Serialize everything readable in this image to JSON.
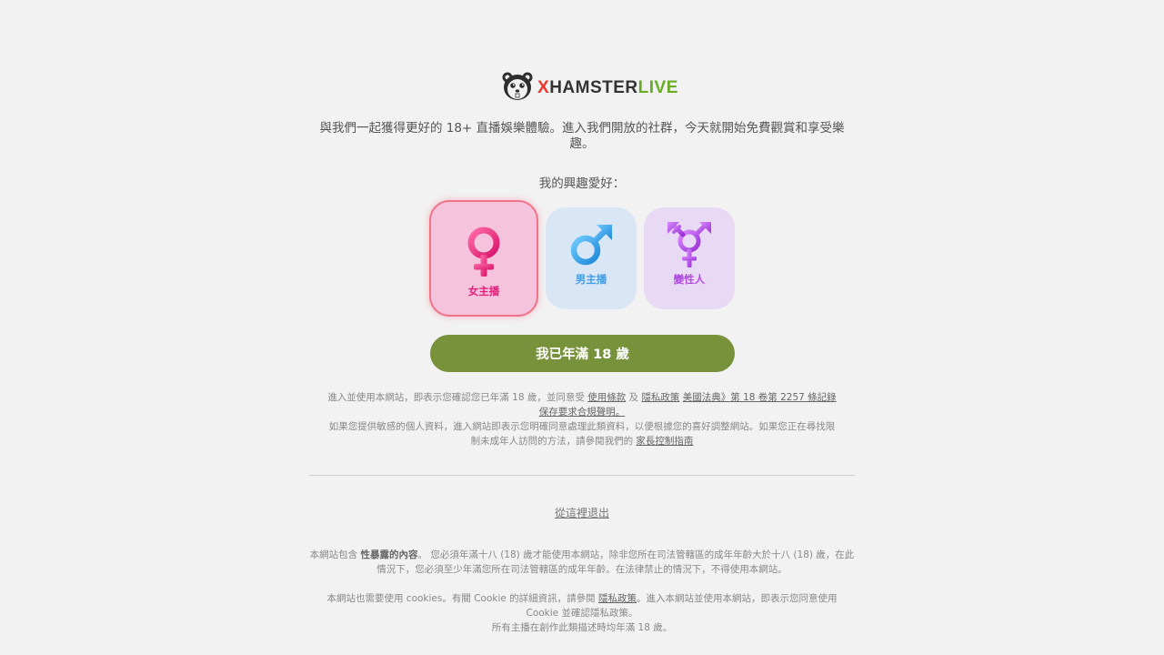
{
  "logo": {
    "icon": "hamster-logo-icon",
    "part1": "X",
    "part2": "HAMSTER",
    "part3": "LIVE",
    "colors": {
      "x": "#e8352e",
      "hamster": "#333333",
      "live": "#6aab26"
    }
  },
  "intro": "與我們一起獲得更好的 18+ 直播娛樂體驗。進入我們開放的社群，今天就開始免費觀賞和享受樂趣。",
  "prefs_label": "我的興趣愛好：",
  "cards": {
    "female": {
      "label": "女主播",
      "icon": "female-symbol-icon",
      "color": "#e61e7c",
      "selected": true
    },
    "male": {
      "label": "男主播",
      "icon": "male-symbol-icon",
      "color": "#3f9ee8"
    },
    "trans": {
      "label": "變性人",
      "icon": "transgender-symbol-icon",
      "color": "#b04be0"
    }
  },
  "age_button": {
    "label": "我已年滿 18 歲",
    "color": "#77923a"
  },
  "legal": {
    "p1_text1": "進入並使用本網站，即表示您確認您已年滿 18 歲，並同意受",
    "terms_link": "使用條款",
    "and": "及",
    "privacy_link": "隱私政策",
    "usc_link": "美國法典》第 18 卷第 2257 條記錄保存要求合規聲明。",
    "p2_text": "如果您提供敏感的個人資料，進入網站即表示您明確同意處理此類資料，以便根據您的喜好調整網站。如果您正在尋找限制未成年人訪問的方法，請參閱我們的",
    "parental_link": "家長控制指南"
  },
  "leave_link": "從這裡退出",
  "footer": {
    "p1_before": "本網站包含",
    "p1_bold": "性暴露的內容",
    "p1_after": "。 您必須年滿十八 (18) 歲才能使用本網站，除非您所在司法管轄區的成年年齡大於十八 (18) 歲，在此情況下，您必須至少年滿您所在司法管轄區的成年年齡。在法律禁止的情況下，不得使用本網站。",
    "p2_before": "本網站也需要使用 cookies。有關 Cookie 的詳細資訊，請參閱",
    "p2_link": "隱私政策",
    "p2_after": "。進入本網站並使用本網站，即表示您同意使用 Cookie 並確認隱私政策。",
    "p3": "所有主播在創作此類描述時均年滿 18 歲。"
  }
}
